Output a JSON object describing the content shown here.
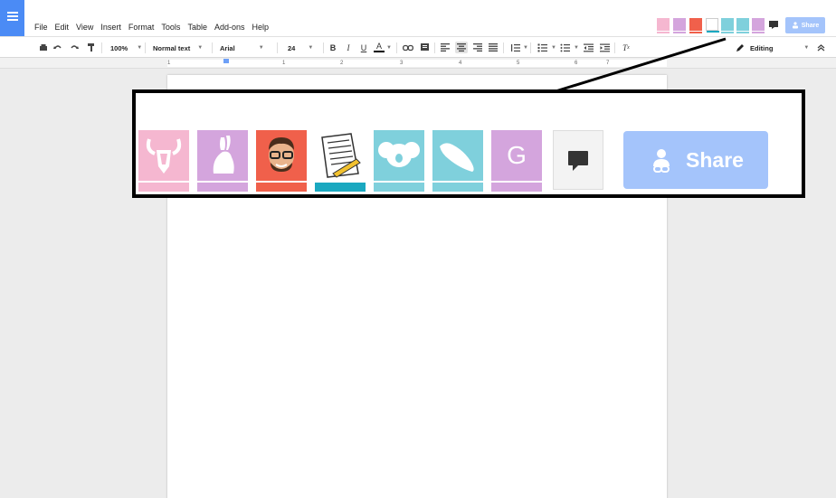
{
  "menu": {
    "items": [
      "File",
      "Edit",
      "View",
      "Insert",
      "Format",
      "Tools",
      "Table",
      "Add-ons",
      "Help"
    ]
  },
  "toolbar": {
    "zoom": "100%",
    "style": "Normal text",
    "font": "Arial",
    "size": "24",
    "mode": "Editing"
  },
  "share": {
    "label": "Share"
  },
  "ruler": {
    "numbers": [
      "1",
      "1",
      "2",
      "3",
      "4",
      "5",
      "6",
      "7"
    ]
  },
  "collaborators": {
    "letter_g": "G",
    "colors": {
      "pink": "#f5b7d0",
      "purple": "#d4a5dd",
      "red": "#f0604b",
      "teal": "#7fd0dc",
      "teal_dark": "#1aa8c0"
    }
  },
  "colors": {
    "docs_blue": "#4b8bf5",
    "share_blue": "#a4c4fb"
  }
}
